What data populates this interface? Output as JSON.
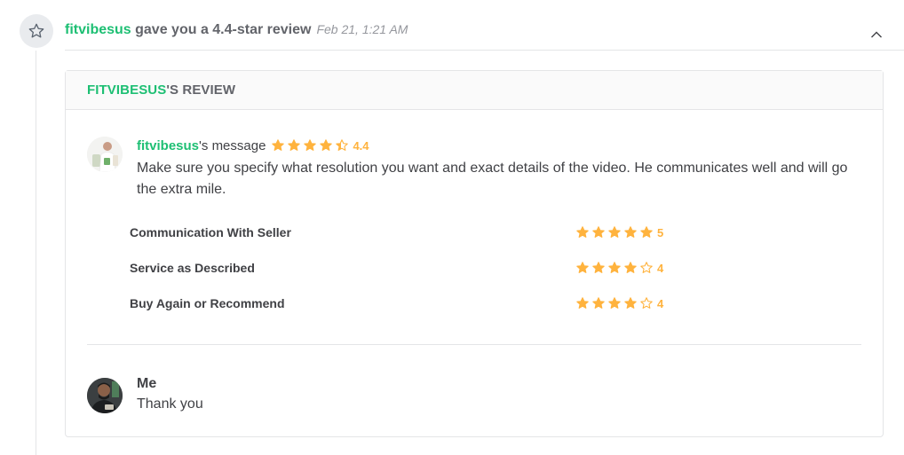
{
  "event": {
    "icon": "star-outline-icon",
    "user": "fitvibesus",
    "action_text": " gave you a 4.4-star review",
    "date": "Feb 21, 1:21 AM"
  },
  "card": {
    "title_user": "FITVIBESUS",
    "title_suffix": "'S REVIEW"
  },
  "review": {
    "user": "fitvibesus",
    "title_suffix": "'s message",
    "rating": 4.4,
    "rating_label": "4.4",
    "text": "Make sure you specify what resolution you want and exact details of the video. He communicates well and will go the extra mile."
  },
  "criteria": [
    {
      "label": "Communication With Seller",
      "rating": 5,
      "rating_label": "5"
    },
    {
      "label": "Service as Described",
      "rating": 4,
      "rating_label": "4"
    },
    {
      "label": "Buy Again or Recommend",
      "rating": 4,
      "rating_label": "4"
    }
  ],
  "reply": {
    "name": "Me",
    "text": "Thank you"
  },
  "colors": {
    "brand_green": "#1dbf73",
    "star": "#ffb33e",
    "text": "#404145",
    "muted": "#95979d"
  }
}
